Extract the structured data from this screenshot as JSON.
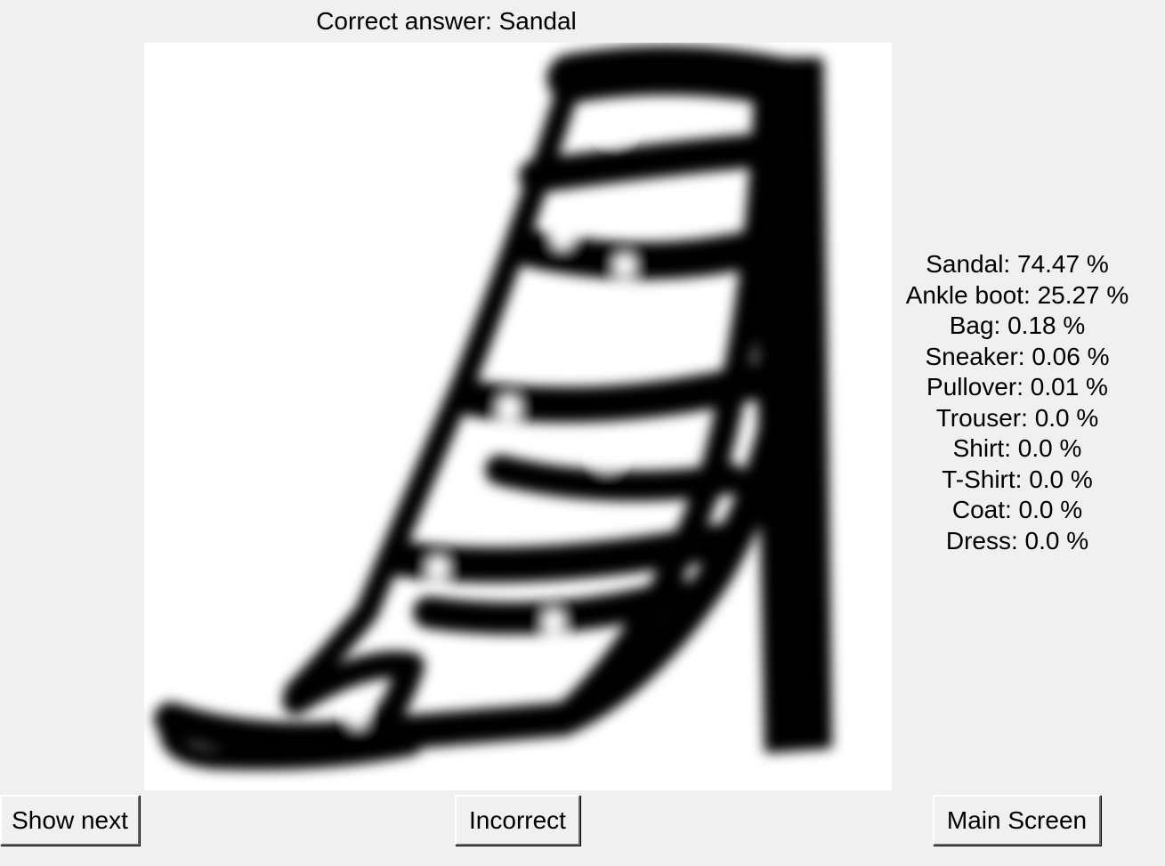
{
  "correct_answer_text": "Correct answer: Sandal",
  "image": {
    "subject": "sandal-image"
  },
  "predictions": [
    {
      "text": "Sandal: 74.47 %"
    },
    {
      "text": "Ankle boot: 25.27 %"
    },
    {
      "text": "Bag: 0.18 %"
    },
    {
      "text": "Sneaker: 0.06 %"
    },
    {
      "text": "Pullover: 0.01 %"
    },
    {
      "text": "Trouser: 0.0 %"
    },
    {
      "text": "Shirt: 0.0 %"
    },
    {
      "text": "T-Shirt: 0.0 %"
    },
    {
      "text": "Coat: 0.0 %"
    },
    {
      "text": "Dress: 0.0 %"
    }
  ],
  "buttons": {
    "show_next": "Show next",
    "incorrect": "Incorrect",
    "main_screen": "Main Screen"
  },
  "colors": {
    "window_bg": "#f0f0f0",
    "image_bg": "#ffffff",
    "ink": "#000000"
  }
}
